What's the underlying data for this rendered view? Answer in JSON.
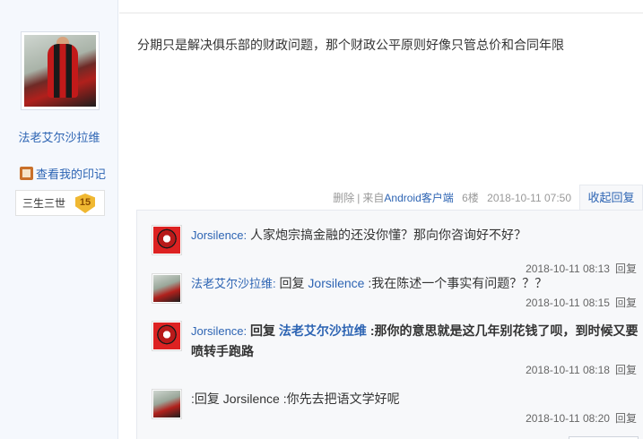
{
  "author": {
    "name": "法老艾尔沙拉维",
    "my_mark_label": "查看我的印记",
    "badge_name": "三生三世",
    "badge_level": "15"
  },
  "post": {
    "content": "分期只是解决俱乐部的财政问题，那个财政公平原则好像只管总价和合同年限",
    "delete_label": "删除",
    "source_prefix": "来自",
    "source_client": "Android客户端",
    "floor": "6楼",
    "time": "2018-10-11 07:50",
    "collapse_label": "收起回复"
  },
  "replies": [
    {
      "user": "Jorsilence:",
      "segments": [
        "人家炮宗搞金融的还没你懂？那向你咨询好不好？"
      ],
      "time": "2018-10-11 08:13",
      "reply_label": "回复"
    },
    {
      "user": "法老艾尔沙拉维:",
      "prefix": "回复",
      "target": "Jorsilence",
      "text": ":我在陈述一个事实有问题？？？",
      "time": "2018-10-11 08:15",
      "reply_label": "回复"
    },
    {
      "user": "Jorsilence:",
      "prefix": "回复",
      "target": "法老艾尔沙拉维",
      "text": ":那你的意思就是这几年别花钱了呗，到时候又要喷转手跑路",
      "time": "2018-10-11 08:18",
      "reply_label": "回复"
    },
    {
      "user": "",
      "prefix": ":回复",
      "target": "Jorsilence",
      "text": ":你先去把语文学好呢",
      "time": "2018-10-11 08:20",
      "reply_label": "回复"
    }
  ]
}
